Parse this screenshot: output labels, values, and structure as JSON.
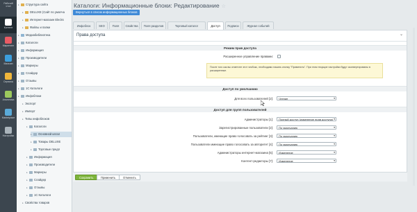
{
  "iconbar": {
    "logo_lines": [
      "Рабочий",
      "стол"
    ],
    "items": [
      {
        "label": "Контент",
        "icon": "document-icon",
        "color": "#ffffff",
        "active": true
      },
      {
        "label": "Маркетинг",
        "icon": "megaphone-icon",
        "color": "#e95b64"
      },
      {
        "label": "Магазин",
        "icon": "cart-icon",
        "color": "#3c9edc"
      },
      {
        "label": "Сервисы",
        "icon": "services-icon",
        "color": "#f0b63b"
      },
      {
        "label": "Аналитика",
        "icon": "analytics-icon",
        "color": "#9cc95d"
      },
      {
        "label": "Marketplace",
        "icon": "marketplace-icon",
        "color": "#5aaad8"
      },
      {
        "label": "Настройки",
        "icon": "gear-icon",
        "color": "#aab4bb"
      }
    ]
  },
  "tree": [
    {
      "label": "Структура сайта",
      "indent": 0,
      "icon": "folder"
    },
    {
      "label": "DELUXE (Сайт по умолча",
      "indent": 1,
      "icon": "folder"
    },
    {
      "label": "Интернет-магазин Elecks",
      "indent": 1,
      "icon": "folder"
    },
    {
      "label": "Файлы и папки",
      "indent": 1,
      "icon": "folder"
    },
    {
      "label": "Медиабиблиотека",
      "indent": 0,
      "icon": "media"
    },
    {
      "label": "Каталоги",
      "indent": 0,
      "icon": "list"
    },
    {
      "label": "Информация",
      "indent": 0,
      "icon": "list"
    },
    {
      "label": "Производители",
      "indent": 0,
      "icon": "list"
    },
    {
      "label": "Маркеры",
      "indent": 0,
      "icon": "list"
    },
    {
      "label": "Слайдер",
      "indent": 0,
      "icon": "list"
    },
    {
      "label": "Отзывы",
      "indent": 0,
      "icon": "list"
    },
    {
      "label": "1C Каталоги",
      "indent": 0,
      "icon": "list"
    },
    {
      "label": "Инфоблоки",
      "indent": 0,
      "icon": "list"
    },
    {
      "label": "Экспорт",
      "indent": 1,
      "icon": "none"
    },
    {
      "label": "Импорт",
      "indent": 1,
      "icon": "none"
    },
    {
      "label": "Типы инфоблоков",
      "indent": 1,
      "icon": "none"
    },
    {
      "label": "Каталоги",
      "indent": 2,
      "icon": "list"
    },
    {
      "label": "Основной катал",
      "indent": 3,
      "icon": "list",
      "selected": true
    },
    {
      "label": "Товары DELUXE",
      "indent": 3,
      "icon": "list"
    },
    {
      "label": "Торговые предл",
      "indent": 3,
      "icon": "list"
    },
    {
      "label": "Информация",
      "indent": 2,
      "icon": "list"
    },
    {
      "label": "Производители",
      "indent": 2,
      "icon": "list"
    },
    {
      "label": "Маркеры",
      "indent": 2,
      "icon": "list"
    },
    {
      "label": "Слайдер",
      "indent": 2,
      "icon": "list"
    },
    {
      "label": "Отзывы",
      "indent": 2,
      "icon": "list"
    },
    {
      "label": "1C Каталоги",
      "indent": 2,
      "icon": "list"
    },
    {
      "label": "Свойства товаров",
      "indent": 1,
      "icon": "none"
    }
  ],
  "page": {
    "title": "Каталоги: Информационные блоки: Редактирование",
    "star": "☆",
    "back_button": "Вернуться в список информационных блоков"
  },
  "tabs": [
    {
      "label": "Инфоблок"
    },
    {
      "label": "SEO"
    },
    {
      "label": "Поля"
    },
    {
      "label": "Свойства"
    },
    {
      "label": "Поля разделов"
    },
    {
      "label": "Торговый каталог"
    },
    {
      "label": "Доступ",
      "active": true
    },
    {
      "label": "Подписи"
    },
    {
      "label": "Журнал событий"
    }
  ],
  "panel": {
    "title": "Права доступа",
    "caret": "⌄",
    "section_mode": "Режим прав доступа",
    "extended_label": "Расширенное управление правами:",
    "notice": "После того как вы отметите этот чекбокс, необходимо нажать кнопку \"Применить\". При этом текущие настройки будут сконвертированы в расширенные.",
    "section_default": "Доступ по умолчанию",
    "all_users_label": "Для всех пользователей [2]:",
    "all_users_value": "Чтение",
    "section_groups": "Доступ для групп пользователей",
    "groups": [
      {
        "label": "Администраторы [1]:",
        "value": "Полный доступ (изменение прав доступа)"
      },
      {
        "label": "Зарегистрированные пользователи [2]:",
        "value": "По умолчанию"
      },
      {
        "label": "Пользователи, имеющие право голосовать за рейтинг [3]:",
        "value": "По умолчанию"
      },
      {
        "label": "Пользователи имеющие право голосовать за авторитет [4]:",
        "value": "По умолчанию"
      },
      {
        "label": "Администраторы интернет-магазина [5]:",
        "value": "Изменение"
      },
      {
        "label": "Контент-редакторы [7]:",
        "value": "Изменение"
      }
    ]
  },
  "footer": {
    "save": "Сохранить",
    "apply": "Применить",
    "cancel": "Отменить"
  }
}
